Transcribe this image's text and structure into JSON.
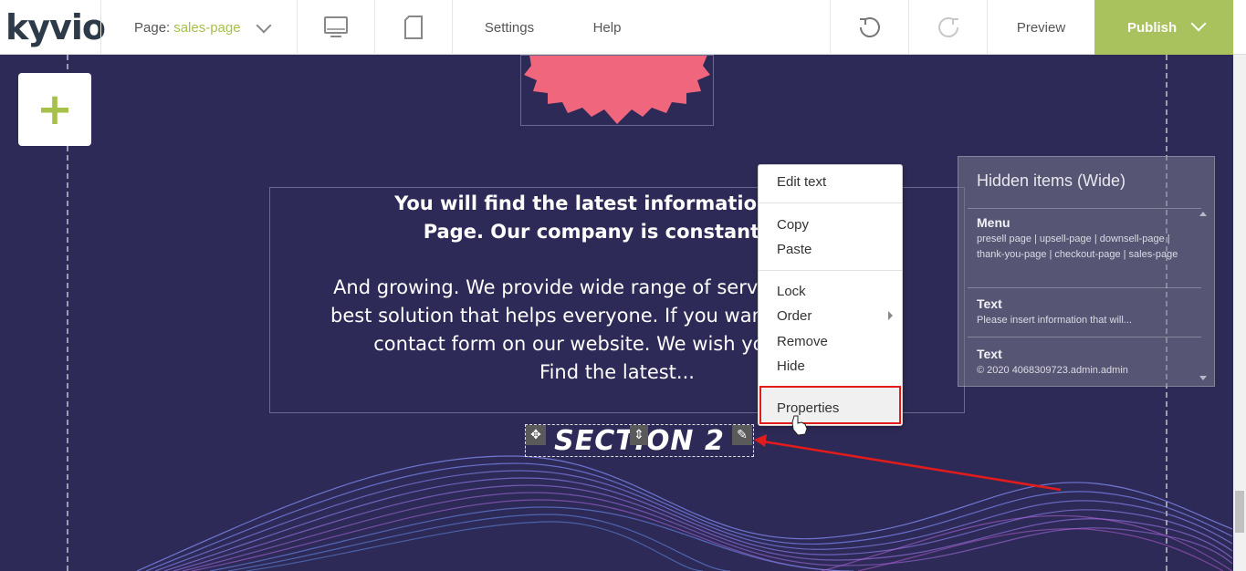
{
  "topbar": {
    "logo_text": "kyvio",
    "page_label": "Page:",
    "page_value": "sales-page",
    "settings": "Settings",
    "help": "Help",
    "preview": "Preview",
    "publish": "Publish"
  },
  "canvas": {
    "add_symbol": "+",
    "heading_text": "You will find the latest information about Page. Our company is constantly ev",
    "heading_line1": "You will find the latest information about",
    "heading_line2": "Page. Our company is constantly ev",
    "body_line1": "And growing. We provide wide range of services. Ou rovide",
    "body_line2": "best solution that helps everyone. If you want to con fill the",
    "body_line3": "contact form on our website. We wish you a goo ...",
    "body_line4": "Find the latest...",
    "section_title": "SECTION 2"
  },
  "context_menu": {
    "edit_text": "Edit text",
    "copy": "Copy",
    "paste": "Paste",
    "lock": "Lock",
    "order": "Order",
    "remove": "Remove",
    "hide": "Hide",
    "properties": "Properties"
  },
  "hidden_panel": {
    "title": "Hidden items (Wide)",
    "items": [
      {
        "title": "Menu",
        "desc": "presell page | upsell-page | downsell-page | thank-you-page | checkout-page | sales-page"
      },
      {
        "title": "Text",
        "desc": "Please insert information that will..."
      },
      {
        "title": "Text",
        "desc": "© 2020 4068309723.admin.admin"
      }
    ]
  },
  "colors": {
    "canvas_bg": "#2e2a57",
    "accent_green": "#a9c25d",
    "badge_pink": "#f0667c",
    "highlight_red": "#e21b1b"
  },
  "icons": [
    "desktop-view-icon",
    "tablet-view-icon",
    "undo-icon",
    "redo-icon",
    "move-icon",
    "edit-pencil-icon",
    "chevron-down-icon",
    "plus-icon"
  ]
}
